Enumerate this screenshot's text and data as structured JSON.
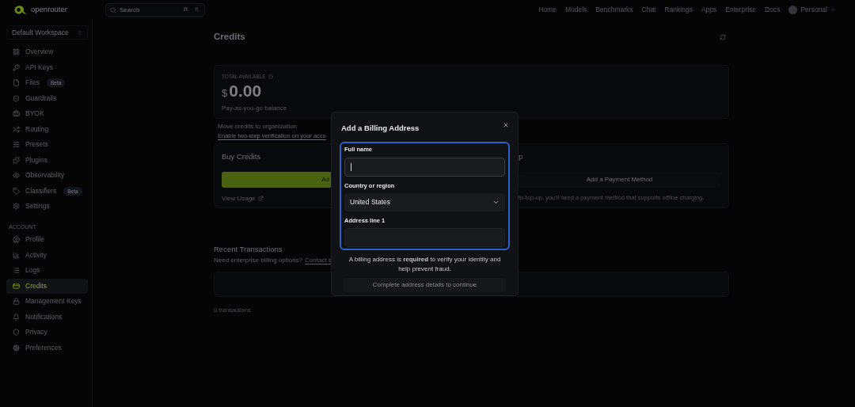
{
  "brand": {
    "name": "openrouter"
  },
  "search": {
    "placeholder": "Search",
    "shortcut": [
      "⌘",
      "K"
    ]
  },
  "nav": [
    "Home",
    "Models",
    "Benchmarks",
    "Chat",
    "Rankings",
    "Apps",
    "Enterprise",
    "Docs"
  ],
  "account_menu": {
    "label": "Personal"
  },
  "workspace": {
    "label": "Default Workspace"
  },
  "sidebar": {
    "items": [
      {
        "label": "Overview",
        "selected": false
      },
      {
        "label": "API Keys",
        "selected": false
      },
      {
        "label": "Files",
        "badge": "Beta",
        "selected": false
      },
      {
        "label": "Guardrails",
        "selected": false
      },
      {
        "label": "BYOK",
        "selected": false
      },
      {
        "label": "Routing",
        "selected": false
      },
      {
        "label": "Presets",
        "selected": false
      },
      {
        "label": "Plugins",
        "selected": false
      },
      {
        "label": "Observability",
        "selected": false
      },
      {
        "label": "Classifiers",
        "badge": "Beta",
        "selected": false
      },
      {
        "label": "Settings",
        "selected": false
      }
    ],
    "account_title": "ACCOUNT",
    "account_items": [
      {
        "label": "Profile",
        "selected": false
      },
      {
        "label": "Activity",
        "selected": false
      },
      {
        "label": "Logs",
        "selected": false
      },
      {
        "label": "Credits",
        "selected": true
      },
      {
        "label": "Management Keys",
        "selected": false
      },
      {
        "label": "Notifications",
        "selected": false
      },
      {
        "label": "Privacy",
        "selected": false
      },
      {
        "label": "Preferences",
        "selected": false
      }
    ]
  },
  "page": {
    "title": "Credits"
  },
  "balance": {
    "label": "TOTAL AVAILABLE",
    "currency": "$",
    "amount": "0.00",
    "caption": "Pay-as-you-go balance"
  },
  "links": [
    "Move credits to organization",
    "Enable two-step verification on your acco"
  ],
  "buy_credits": {
    "title": "Buy Credits",
    "button": "Ad",
    "link": "View Usage"
  },
  "auto_top_up": {
    "title": "p",
    "button": "Add a Payment Method",
    "note": "to-top-up, you'll need a payment method that supports offline charging."
  },
  "transactions": {
    "title": "Recent Transactions",
    "subtitle": "Need enterprise billing options?",
    "link": "Contact s",
    "count": "0 transactions"
  },
  "dialog": {
    "title": "Add a Billing Address",
    "fields": [
      {
        "kind": "text",
        "label": "Full name",
        "focused": true
      },
      {
        "kind": "select",
        "label": "Country or region",
        "value": "United States",
        "focused": false
      },
      {
        "kind": "text",
        "label": "Address line 1",
        "focused": false
      }
    ],
    "note": "A billing address is **required** to verify your identity and help prevent fraud.",
    "submit": {
      "label": "Complete address details to continue",
      "disabled": true
    }
  }
}
